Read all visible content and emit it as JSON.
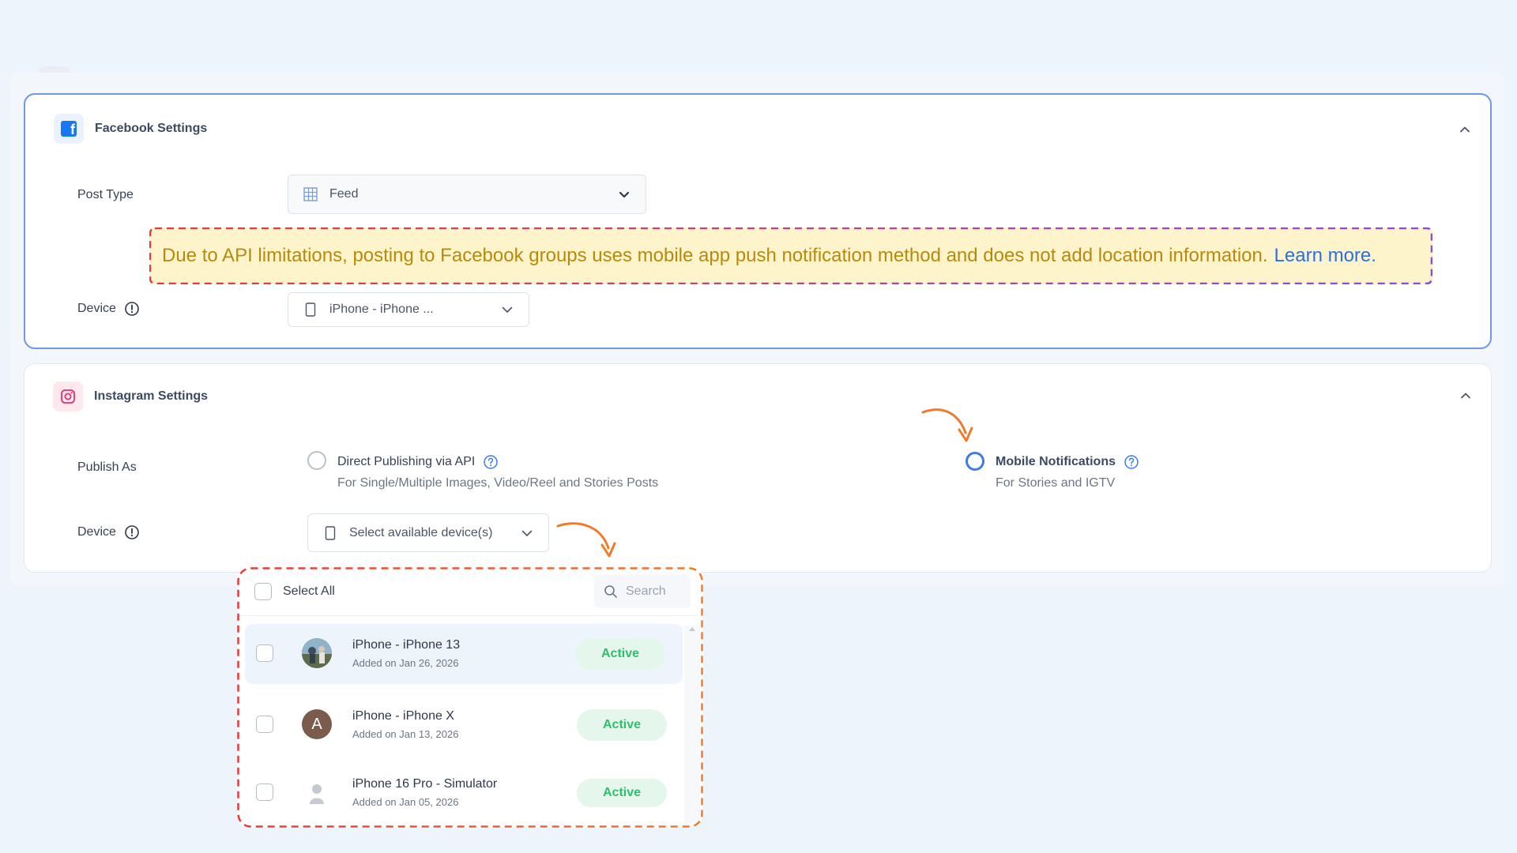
{
  "facebook": {
    "title": "Facebook Settings",
    "post_type_label": "Post Type",
    "post_type_value": "Feed",
    "warning_text": "Due to API limitations, posting to Facebook groups uses mobile app push notification method and does not add location information.",
    "warning_link": "Learn more.",
    "device_label": "Device",
    "device_value": "iPhone - iPhone ..."
  },
  "instagram": {
    "title": "Instagram Settings",
    "publish_label": "Publish As",
    "option_api_title": "Direct Publishing via API",
    "option_api_sub": "For Single/Multiple Images, Video/Reel and Stories Posts",
    "option_mobile_title": "Mobile Notifications",
    "option_mobile_sub": "For Stories and IGTV",
    "selected_option": "Mobile Notifications",
    "device_label": "Device",
    "device_placeholder": "Select available device(s)"
  },
  "device_dropdown": {
    "select_all": "Select All",
    "search_placeholder": "Search",
    "devices": [
      {
        "name": "iPhone - iPhone 13",
        "added": "Added on Jan 26, 2026",
        "status": "Active",
        "avatar": "photo"
      },
      {
        "name": "iPhone - iPhone X",
        "added": "Added on Jan 13, 2026",
        "status": "Active",
        "avatar": "A"
      },
      {
        "name": "iPhone 16 Pro - Simulator",
        "added": "Added on Jan 05, 2026",
        "status": "Active",
        "avatar": "person-icon"
      }
    ]
  },
  "colors": {
    "accent": "#3d7be8",
    "active_green": "#2fbf6a",
    "warning_bg": "#fdf4cc",
    "annotation_orange": "#f07a2a"
  }
}
